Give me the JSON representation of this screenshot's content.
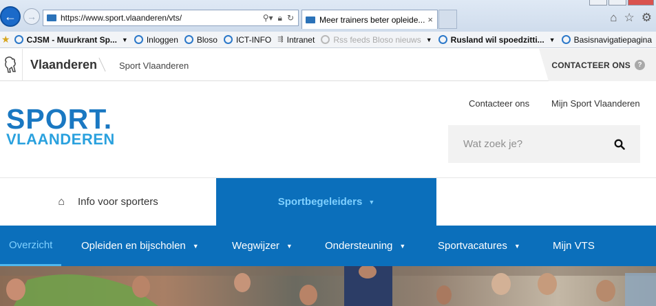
{
  "browser": {
    "url": "https://www.sport.vlaanderen/vts/",
    "tab_title": "Meer trainers beter opleide...",
    "tab_close": "×",
    "back_icon": "←",
    "forward_icon": "→"
  },
  "favorites": [
    {
      "label": "CJSM - Muurkrant Sp...",
      "icon": "ie-icon",
      "bold": true,
      "dropdown": true
    },
    {
      "label": "Inloggen",
      "icon": "ie-icon"
    },
    {
      "label": "Bloso",
      "icon": "ie-icon"
    },
    {
      "label": "ICT-INFO",
      "icon": "ie-icon"
    },
    {
      "label": "Intranet",
      "icon": "network-icon"
    },
    {
      "label": "Rss feeds Bloso nieuws",
      "icon": "rss-icon",
      "dropdown": true
    },
    {
      "label": "Rusland wil spoedzitti...",
      "icon": "ie-icon",
      "bold": true,
      "dropdown": true
    },
    {
      "label": "Basisnavigatiepagina",
      "icon": "ie-icon"
    }
  ],
  "gov_header": {
    "title": "Vlaanderen",
    "subtitle": "Sport Vlaanderen",
    "contact": "CONTACTEER ONS",
    "help": "?"
  },
  "brand": {
    "line1": "SPORT.",
    "line2": "VLAANDEREN"
  },
  "top_links": {
    "contact": "Contacteer ons",
    "my_account": "Mijn Sport Vlaanderen"
  },
  "search": {
    "placeholder": "Wat zoek je?"
  },
  "main_tabs": {
    "home": "Info voor sporters",
    "coaches": "Sportbegeleiders"
  },
  "sub_nav": [
    {
      "label": "Overzicht",
      "active": true,
      "dropdown": false
    },
    {
      "label": "Opleiden en bijscholen",
      "active": false,
      "dropdown": true
    },
    {
      "label": "Wegwijzer",
      "active": false,
      "dropdown": true
    },
    {
      "label": "Ondersteuning",
      "active": false,
      "dropdown": true
    },
    {
      "label": "Sportvacatures",
      "active": false,
      "dropdown": true
    },
    {
      "label": "Mijn VTS",
      "active": false,
      "dropdown": false
    }
  ],
  "colors": {
    "brand_blue": "#0b6fbb",
    "accent_light_blue": "#7fd0ff",
    "logo_blue": "#1a78c2",
    "logo_light": "#2aa1de"
  }
}
